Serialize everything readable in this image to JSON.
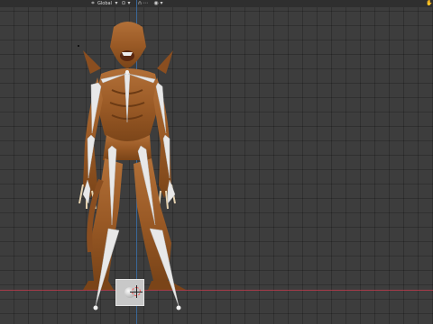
{
  "header": {
    "orientation_label": "Global",
    "orientation_icon": "axes-icon",
    "pivot_icon": "pivot-point-icon",
    "snap_icon": "magnet-icon",
    "proportional_icon": "proportional-editing-icon",
    "nav_icon": "hand-pan-icon"
  },
  "scene": {
    "object": "creature-model-with-armature",
    "origin_widget": "object-origin",
    "axis_colors": {
      "x": "#b13b4a",
      "y": "#3a6ea8"
    },
    "skin_color": "#a5642c",
    "bone_color": "#e6e6e6"
  }
}
